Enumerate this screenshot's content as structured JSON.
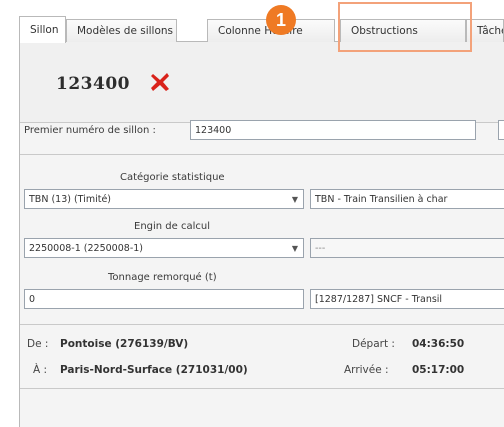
{
  "tabs": [
    {
      "label": "Sillon",
      "active": true
    },
    {
      "label": "Modèles de sillons",
      "active": false
    },
    {
      "label": "Colonne Horaire",
      "active": false
    },
    {
      "label": "Obstructions",
      "active": false
    },
    {
      "label": "Tâches",
      "active": false
    }
  ],
  "callout": {
    "number": "1",
    "color": "#ef7a24"
  },
  "header": {
    "id": "123400",
    "delete_icon": "red-x-icon",
    "delete_color": "#d9221a"
  },
  "form": {
    "premier_label": "Premier numéro de sillon :",
    "premier_value": "123400",
    "categorie_label": "Catégorie statistique",
    "categorie_value": "TBN (13) (Timité)",
    "categorie_desc": "TBN - Train Transilien à char",
    "engin_label": "Engin de calcul",
    "engin_value": "2250008-1 (2250008-1)",
    "engin_desc": "---",
    "tonnage_label": "Tonnage remorqué (t)",
    "tonnage_value": "0",
    "tonnage_desc": "[1287/1287] SNCF - Transil"
  },
  "route": {
    "from_key": "De :",
    "from_value": "Pontoise (276139/BV)",
    "depart_key": "Départ :",
    "depart_value": "04:36:50",
    "to_key": "À :",
    "to_value": "Paris-Nord-Surface (271031/00)",
    "arrivee_key": "Arrivée :",
    "arrivee_value": "05:17:00"
  }
}
